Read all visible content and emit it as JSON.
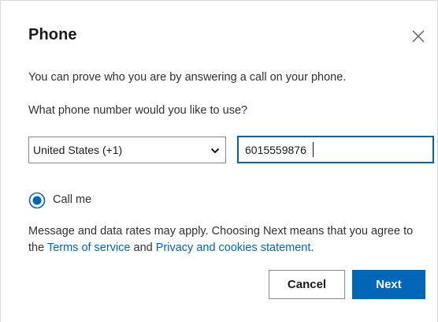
{
  "dialog": {
    "title": "Phone",
    "description": "You can prove who you are by answering a call on your phone.",
    "question": "What phone number would you like to use?"
  },
  "country_select": {
    "selected": "United States (+1)"
  },
  "phone_input": {
    "value": "6015559876"
  },
  "method": {
    "label": "Call me",
    "selected": true
  },
  "disclaimer": {
    "text_before": "Message and data rates may apply. Choosing Next means that you agree to the ",
    "terms_link": "Terms of service",
    "text_middle": " and ",
    "privacy_link": "Privacy and cookies statement",
    "text_after": "."
  },
  "buttons": {
    "cancel": "Cancel",
    "next": "Next"
  },
  "colors": {
    "accent": "#0067b8",
    "text": "#323130",
    "border": "#8a8886"
  },
  "icons": {
    "close": "close-icon",
    "chevron": "chevron-down-icon",
    "radio": "radio-selected-icon"
  }
}
